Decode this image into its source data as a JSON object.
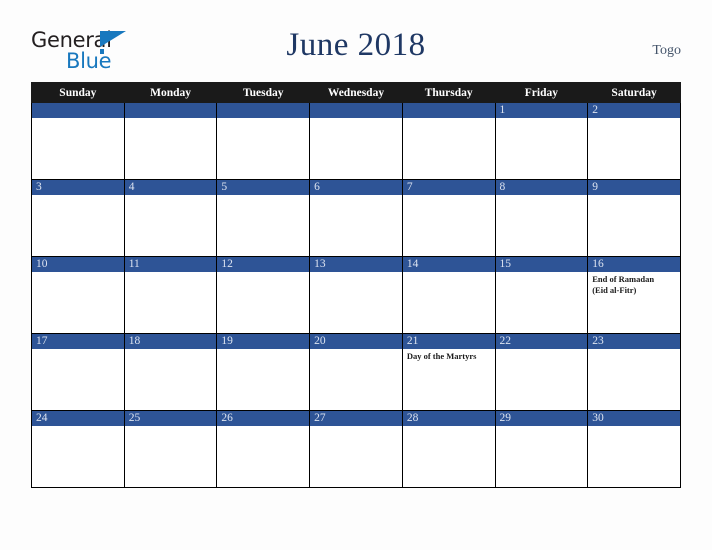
{
  "brand": {
    "name_top": "General",
    "name_bottom": "Blue",
    "triangle_color": "#1878be",
    "text_color": "#231f20"
  },
  "header": {
    "title": "June 2018",
    "region": "Togo",
    "title_color": "#1f3864",
    "region_color": "#44546a"
  },
  "calendar": {
    "header_bg": "#1a1a1a",
    "daynum_bg": "#2e5496",
    "weekdays": [
      "Sunday",
      "Monday",
      "Tuesday",
      "Wednesday",
      "Thursday",
      "Friday",
      "Saturday"
    ],
    "weeks": [
      [
        {
          "day": "",
          "event": ""
        },
        {
          "day": "",
          "event": ""
        },
        {
          "day": "",
          "event": ""
        },
        {
          "day": "",
          "event": ""
        },
        {
          "day": "",
          "event": ""
        },
        {
          "day": "1",
          "event": ""
        },
        {
          "day": "2",
          "event": ""
        }
      ],
      [
        {
          "day": "3",
          "event": ""
        },
        {
          "day": "4",
          "event": ""
        },
        {
          "day": "5",
          "event": ""
        },
        {
          "day": "6",
          "event": ""
        },
        {
          "day": "7",
          "event": ""
        },
        {
          "day": "8",
          "event": ""
        },
        {
          "day": "9",
          "event": ""
        }
      ],
      [
        {
          "day": "10",
          "event": ""
        },
        {
          "day": "11",
          "event": ""
        },
        {
          "day": "12",
          "event": ""
        },
        {
          "day": "13",
          "event": ""
        },
        {
          "day": "14",
          "event": ""
        },
        {
          "day": "15",
          "event": ""
        },
        {
          "day": "16",
          "event": "End of Ramadan\n(Eid al-Fitr)"
        }
      ],
      [
        {
          "day": "17",
          "event": ""
        },
        {
          "day": "18",
          "event": ""
        },
        {
          "day": "19",
          "event": ""
        },
        {
          "day": "20",
          "event": ""
        },
        {
          "day": "21",
          "event": "Day of the Martyrs"
        },
        {
          "day": "22",
          "event": ""
        },
        {
          "day": "23",
          "event": ""
        }
      ],
      [
        {
          "day": "24",
          "event": ""
        },
        {
          "day": "25",
          "event": ""
        },
        {
          "day": "26",
          "event": ""
        },
        {
          "day": "27",
          "event": ""
        },
        {
          "day": "28",
          "event": ""
        },
        {
          "day": "29",
          "event": ""
        },
        {
          "day": "30",
          "event": ""
        }
      ]
    ]
  }
}
